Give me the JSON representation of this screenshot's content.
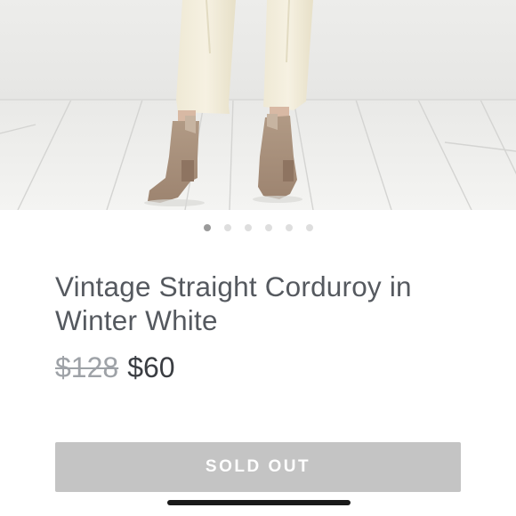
{
  "product": {
    "title": "Vintage Straight Corduroy in Winter White",
    "original_price": "$128",
    "sale_price": "$60",
    "cta_label": "SOLD OUT"
  },
  "carousel": {
    "dot_count": 6,
    "active_index": 0
  },
  "colors": {
    "title": "#55595f",
    "price_old": "#9ea2a7",
    "button_bg": "#c4c4c4",
    "dot_active": "#9a9a9a",
    "dot_inactive": "#dedede"
  }
}
